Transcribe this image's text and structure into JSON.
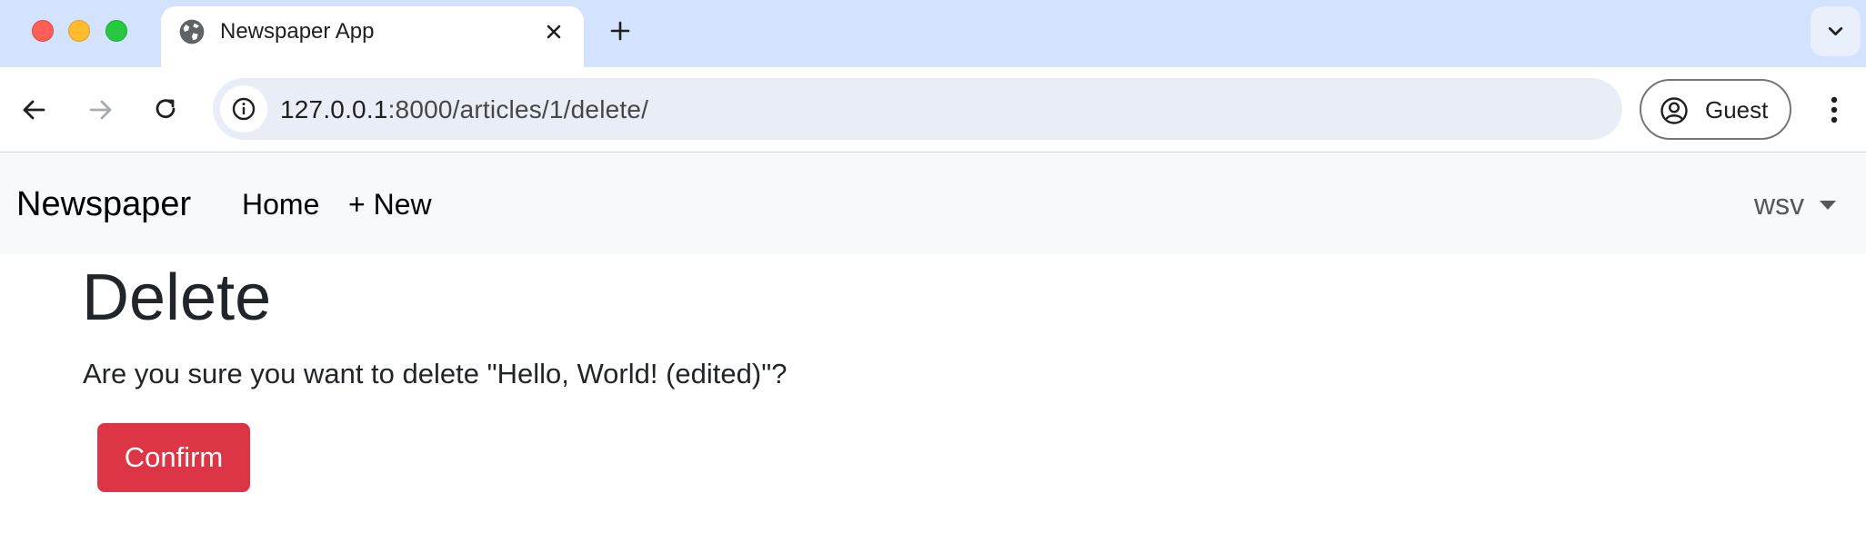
{
  "browser": {
    "tab": {
      "title": "Newspaper App",
      "icon": "globe-icon"
    },
    "address_bar": {
      "host": "127.0.0.1",
      "path": ":8000/articles/1/delete/"
    },
    "profile": {
      "label": "Guest"
    }
  },
  "app": {
    "brand": "Newspaper",
    "nav": {
      "home": "Home",
      "new": "+ New"
    },
    "user": "wsv"
  },
  "content": {
    "title": "Delete",
    "message": "Are you sure you want to delete \"Hello, World! (edited)\"?",
    "confirm_label": "Confirm"
  },
  "colors": {
    "danger": "#dc3545",
    "tabstrip": "#d3e3fd",
    "navbar_bg": "#f8f9fa"
  }
}
